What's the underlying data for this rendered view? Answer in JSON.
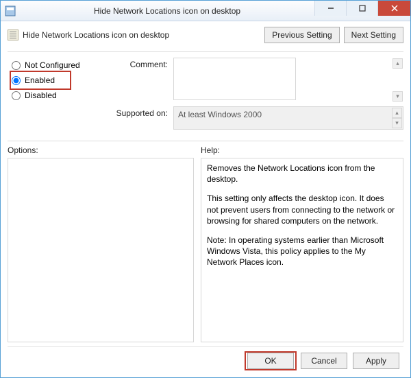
{
  "titlebar": {
    "title": "Hide Network Locations icon on desktop"
  },
  "header": {
    "policy_title": "Hide Network Locations icon on desktop",
    "prev": "Previous Setting",
    "next": "Next Setting"
  },
  "state": {
    "not_configured": "Not Configured",
    "enabled": "Enabled",
    "disabled": "Disabled",
    "selected": "Enabled"
  },
  "comment": {
    "label": "Comment:",
    "value": ""
  },
  "supported": {
    "label": "Supported on:",
    "value": "At least Windows 2000"
  },
  "panes": {
    "options_label": "Options:",
    "help_label": "Help:"
  },
  "help": {
    "p1": "Removes the Network Locations icon from the desktop.",
    "p2": "This setting only affects the desktop icon. It does not prevent users from connecting to the network or browsing for shared computers on the network.",
    "p3": "Note: In operating systems earlier than Microsoft Windows Vista, this policy applies to the My Network Places icon."
  },
  "footer": {
    "ok": "OK",
    "cancel": "Cancel",
    "apply": "Apply"
  }
}
